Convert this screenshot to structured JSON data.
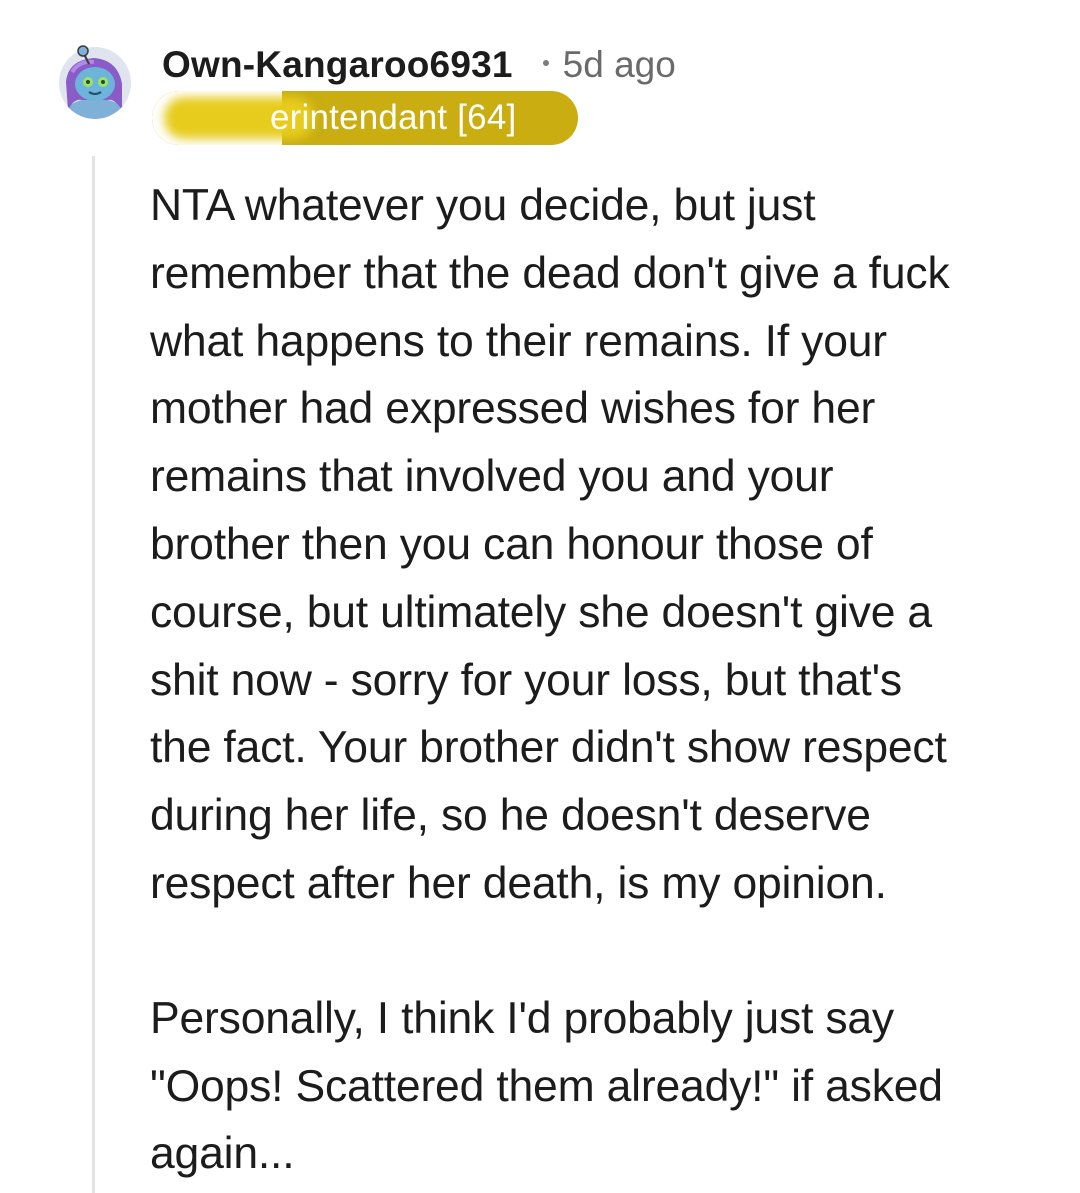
{
  "comment": {
    "username": "Own-Kangaroo6931",
    "timestamp": "5d ago",
    "flair": "erintendant [64]",
    "avatar": "snoo-avatar-icon",
    "paragraphs": [
      "NTA whatever you decide, but just\nremember that the dead don't give a fuck\nwhat happens to their remains. If your\nmother had expressed wishes for her\nremains that involved you and your\nbrother then you can honour those of\ncourse, but ultimately she doesn't give a\nshit now - sorry for your loss, but that's\nthe fact. Your brother didn't show respect\nduring her life, so he doesn't deserve\nrespect after her death, is my opinion.",
      "Personally, I think I'd probably just say\n\"Oops! Scattered them already!\" if asked\nagain..."
    ]
  },
  "colors": {
    "flair_background": "#c9ad11",
    "text": "#1c1c1c",
    "meta_text": "#6a6a6a",
    "thread_line": "#e3e3e3"
  }
}
